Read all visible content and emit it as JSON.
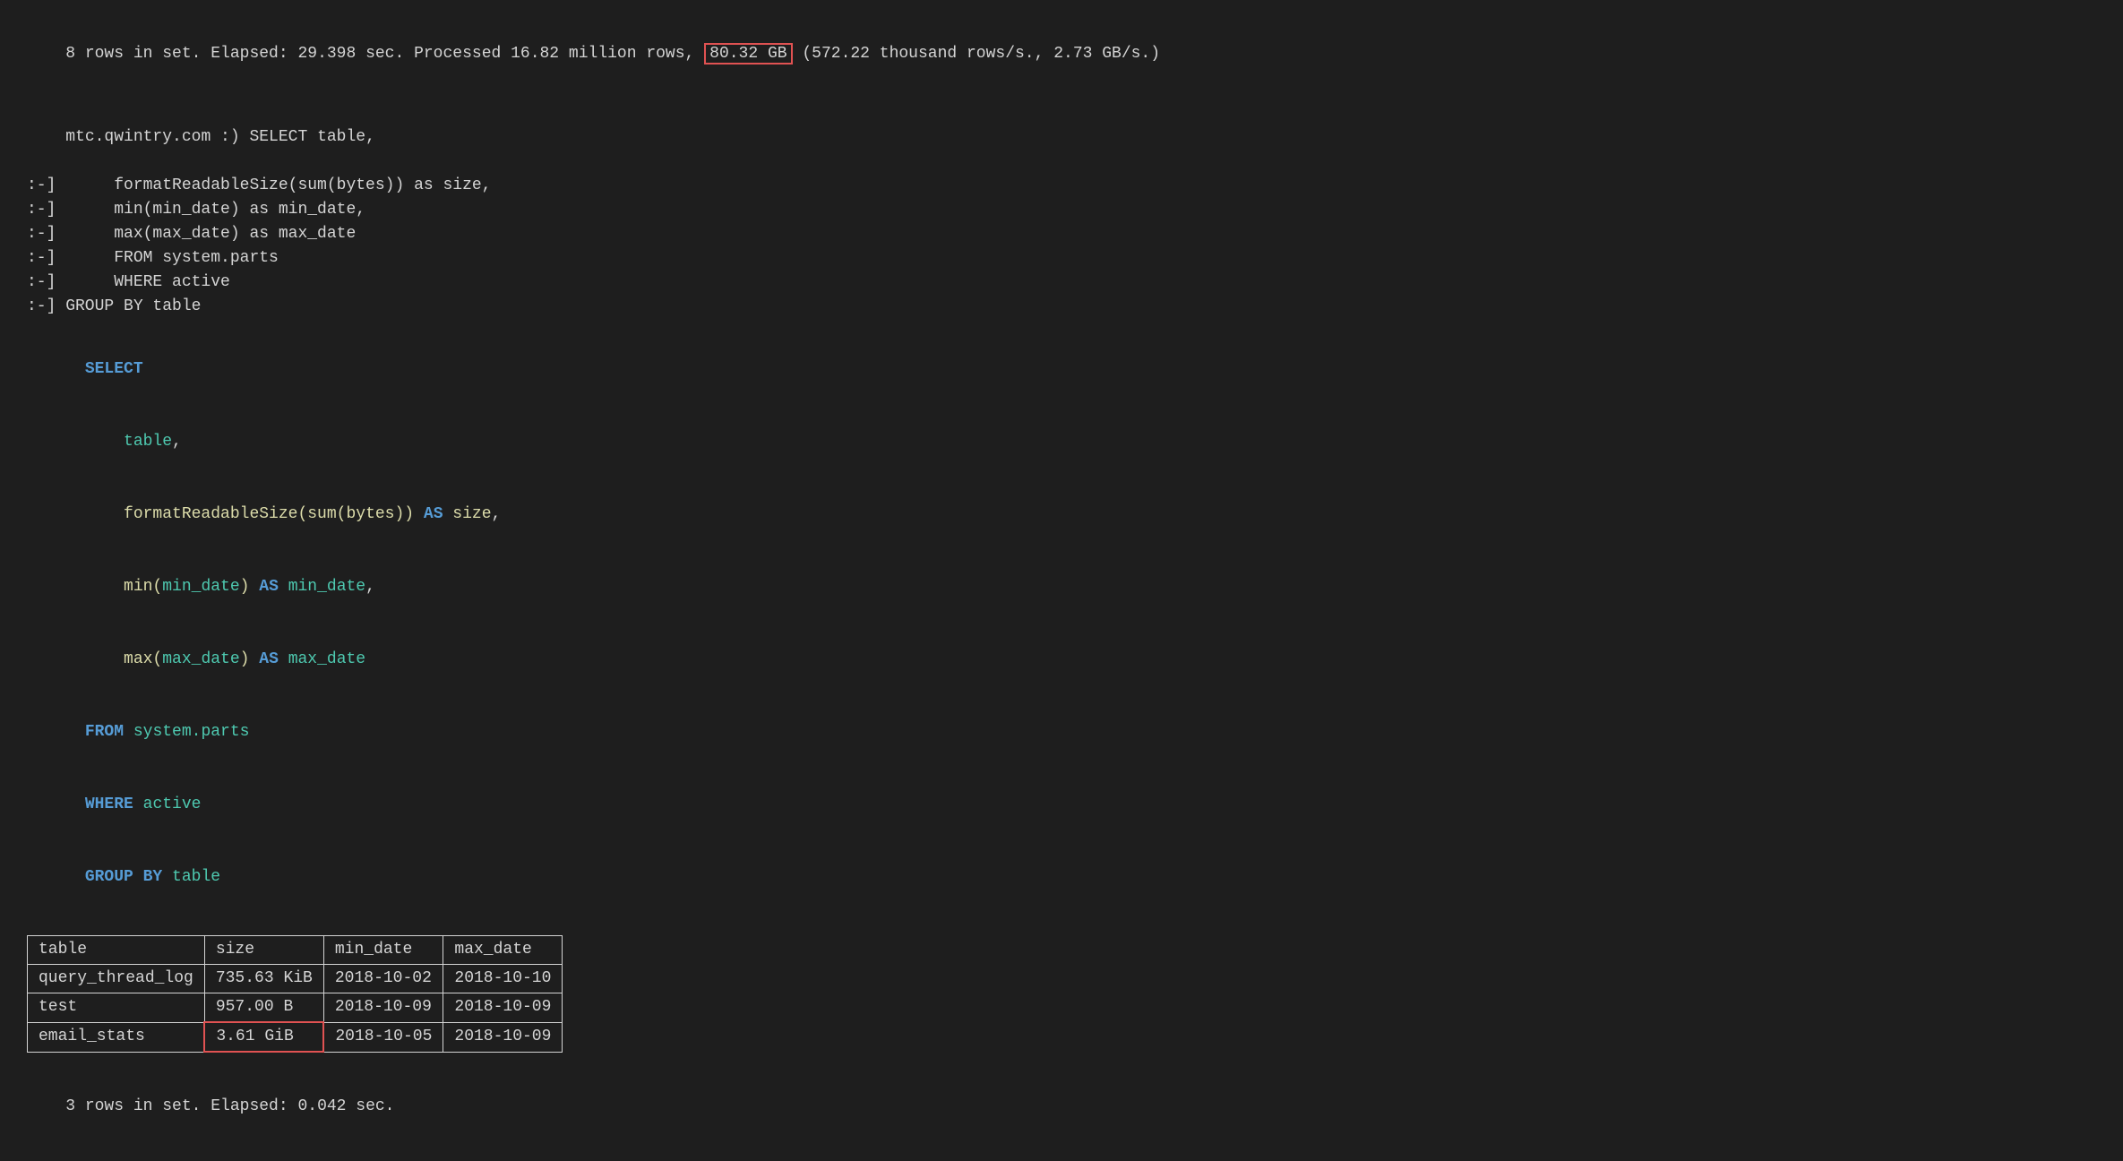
{
  "terminal": {
    "stats_line_prefix": "8 rows in set. Elapsed: 29.398 sec. Processed 16.82 million rows, ",
    "stats_highlighted": "80.32 GB",
    "stats_line_suffix": " (572.22 thousand rows/s., 2.73 GB/s.)",
    "prompt": "mtc.qwintry.com :) SELECT table,",
    "prompt_lines": [
      ":-]      formatReadableSize(sum(bytes)) as size,",
      ":-]      min(min_date) as min_date,",
      ":-]      max(max_date) as max_date",
      ":-]      FROM system.parts",
      ":-]      WHERE active",
      ":-] GROUP BY table"
    ],
    "sql_keyword_select": "SELECT",
    "sql_select_fields": [
      {
        "text": "    table,",
        "color": "cyan"
      },
      {
        "text": "    formatReadableSize(sum(bytes)) AS size,",
        "color": "yellow"
      },
      {
        "text": "    min(min_date) AS min_date,",
        "color": "mixed_min"
      },
      {
        "text": "    max(max_date) AS max_date",
        "color": "mixed_max"
      }
    ],
    "sql_from": "FROM",
    "sql_from_table": "system.parts",
    "sql_where": "WHERE",
    "sql_where_value": "active",
    "sql_group": "GROUP BY",
    "sql_group_field": "table",
    "table_headers": [
      "table",
      "size",
      "min_date",
      "max_date"
    ],
    "table_rows": [
      [
        "query_thread_log",
        "735.63 KiB",
        "2018-10-02",
        "2018-10-10"
      ],
      [
        "test",
        "957.00 B",
        "2018-10-09",
        "2018-10-09"
      ],
      [
        "email_stats",
        "3.61 GiB",
        "2018-10-05",
        "2018-10-09"
      ]
    ],
    "footer_line": "3 rows in set. Elapsed: 0.042 sec."
  }
}
